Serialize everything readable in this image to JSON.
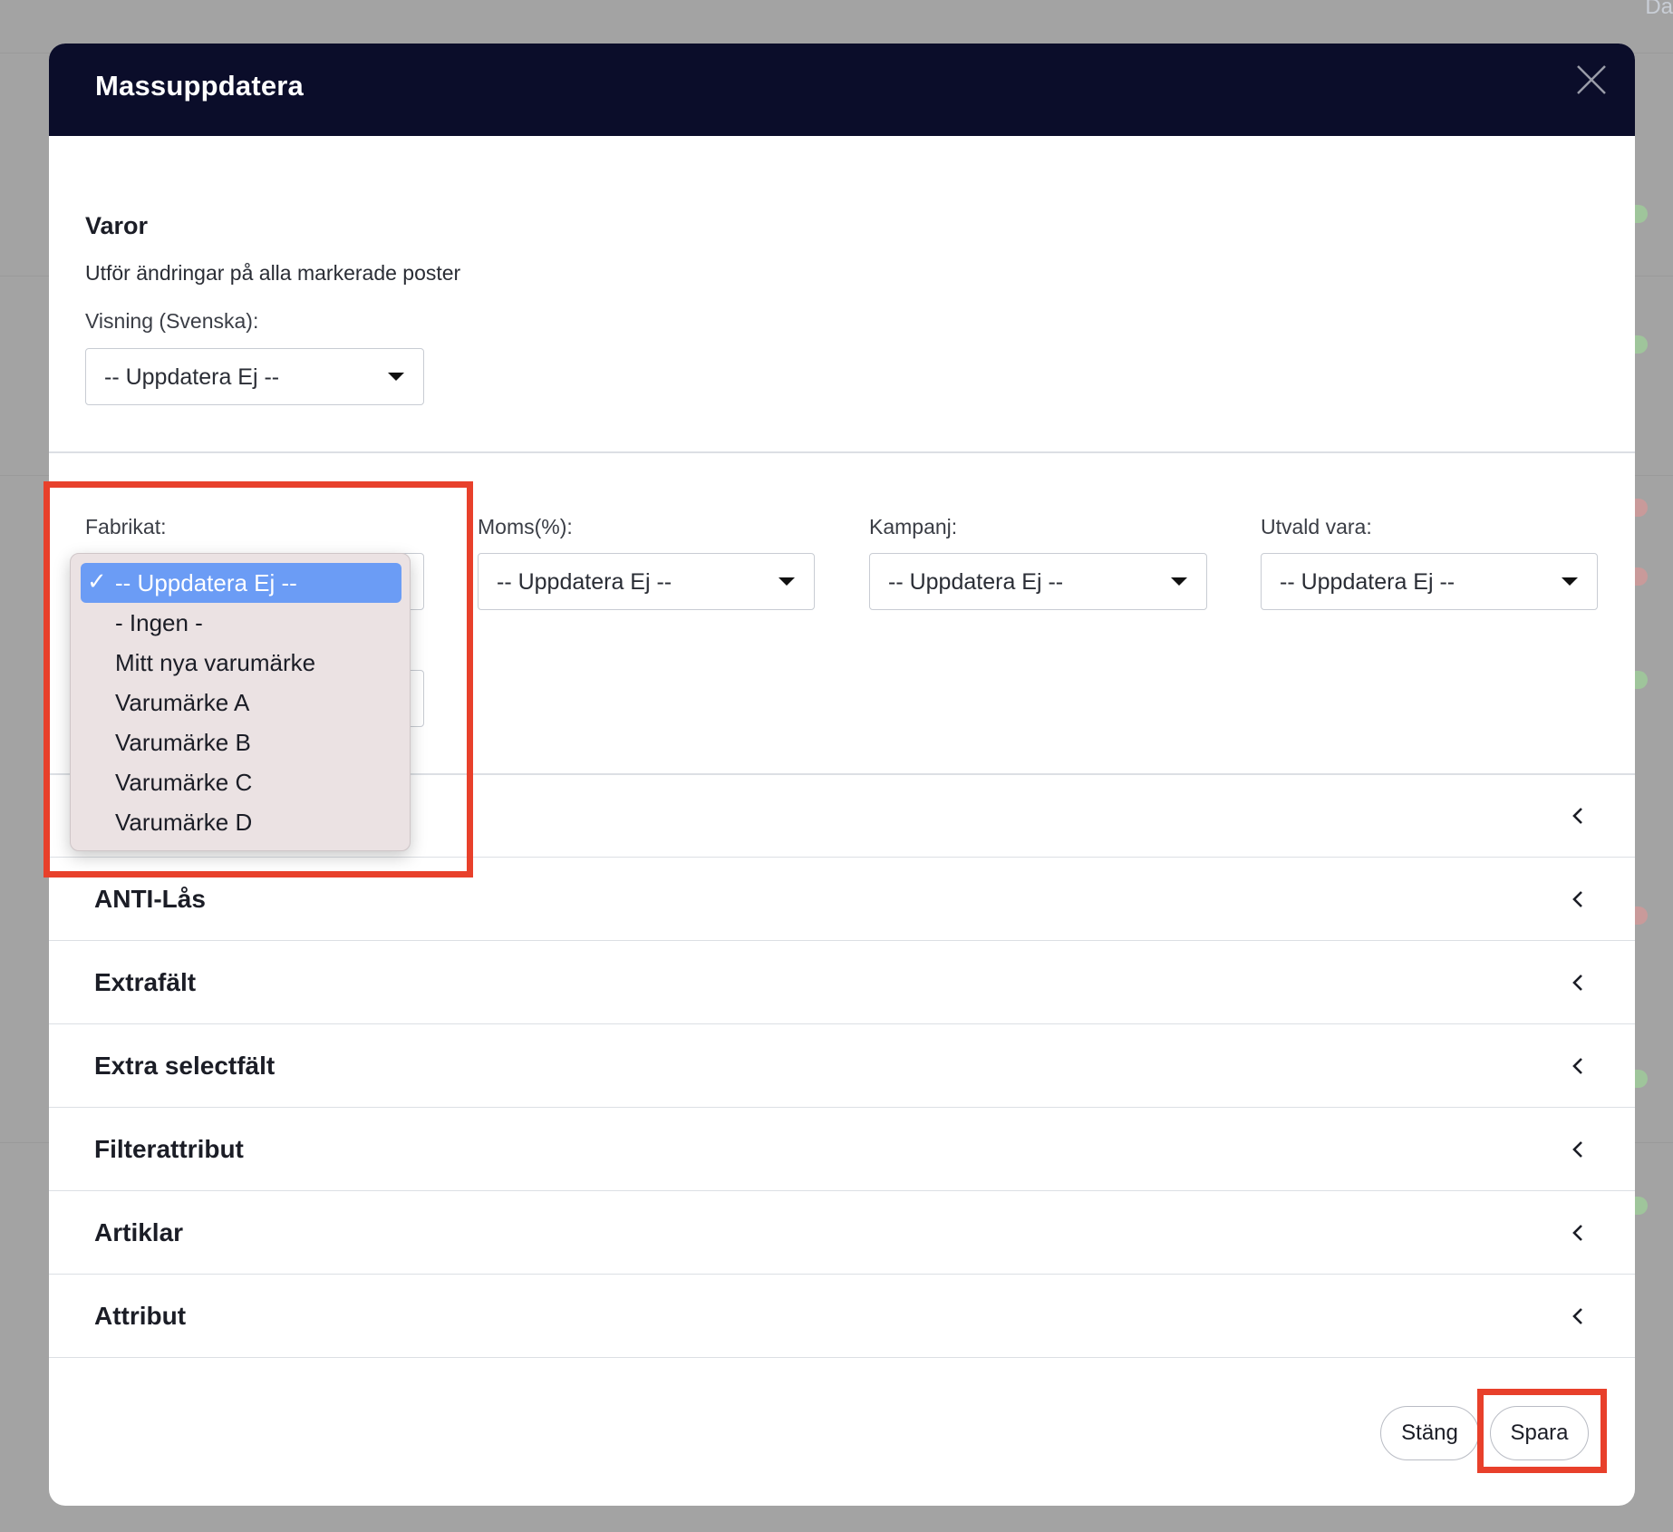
{
  "background": {
    "corner_text": "Da"
  },
  "modal": {
    "title": "Massuppdatera",
    "close_icon": "close-icon"
  },
  "varor": {
    "heading": "Varor",
    "subtext": "Utför ändringar på alla markerade poster",
    "visning_label": "Visning (Svenska):",
    "visning_value": "-- Uppdatera Ej --"
  },
  "fields": {
    "fabrikat_label": "Fabrikat:",
    "moms_label": "Moms(%):",
    "moms_value": "-- Uppdatera Ej --",
    "kampanj_label": "Kampanj:",
    "kampanj_value": "-- Uppdatera Ej --",
    "utvald_label": "Utvald vara:",
    "utvald_value": "-- Uppdatera Ej --"
  },
  "fabrikat_dropdown": {
    "selected_index": 0,
    "options": [
      "-- Uppdatera Ej --",
      "- Ingen -",
      "Mitt nya varumärke",
      "Varumärke A",
      "Varumärke B",
      "Varumärke C",
      "Varumärke D"
    ]
  },
  "accordion": [
    {
      "title": "ANTI-Lås"
    },
    {
      "title": "Extrafält"
    },
    {
      "title": "Extra selectfält"
    },
    {
      "title": "Filterattribut"
    },
    {
      "title": "Artiklar"
    },
    {
      "title": "Attribut"
    }
  ],
  "footer": {
    "close_label": "Stäng",
    "save_label": "Spara"
  },
  "colors": {
    "header_bg": "#0b0d2a",
    "highlight": "#e8402b",
    "selected_option": "#6b9cf5"
  }
}
